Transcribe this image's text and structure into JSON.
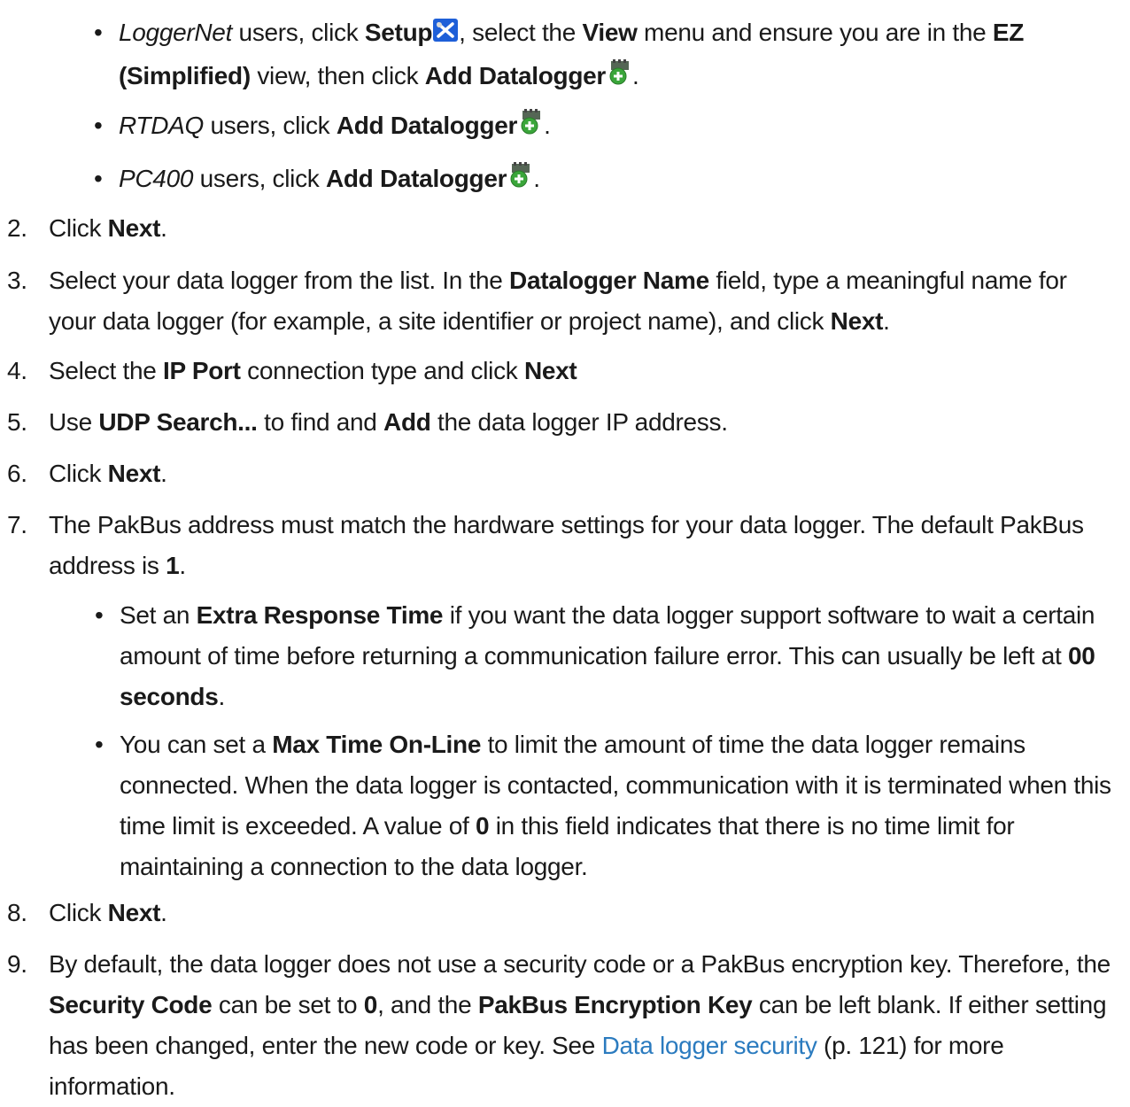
{
  "top_bullets": [
    {
      "app": "LoggerNet",
      "t1": " users, click ",
      "setup": "Setup",
      "t2": ", select the ",
      "view": "View",
      "t3": " menu and ensure you are in the ",
      "ez": "EZ (Simplified)",
      "t4": " view, then click ",
      "add": "Add Datalogger",
      "t5": "."
    },
    {
      "app": "RTDAQ",
      "t1": " users, click ",
      "add": "Add Datalogger",
      "t2": "."
    },
    {
      "app": "PC400",
      "t1": " users, click ",
      "add": "Add Datalogger",
      "t2": "."
    }
  ],
  "steps": {
    "s2": {
      "num": "2.",
      "t1": "Click ",
      "b1": "Next",
      "t2": "."
    },
    "s3": {
      "num": "3.",
      "t1": "Select your data logger from the list. In the ",
      "b1": "Datalogger Name",
      "t2": " field, type a meaningful name for your data logger (for example, a site identifier or project name), and click ",
      "b2": "Next",
      "t3": "."
    },
    "s4": {
      "num": "4.",
      "t1": "Select the ",
      "b1": "IP Port",
      "t2": " connection type and click ",
      "b2": "Next"
    },
    "s5": {
      "num": "5.",
      "t1": "Use ",
      "b1": "UDP Search...",
      "t2": " to find and ",
      "b2": "Add",
      "t3": " the data logger IP address."
    },
    "s6": {
      "num": "6.",
      "t1": "Click ",
      "b1": "Next",
      "t2": "."
    },
    "s7": {
      "num": "7.",
      "t1": "The PakBus address must match the hardware settings for your data logger. The default PakBus address is ",
      "b1": "1",
      "t2": "."
    },
    "s7a": {
      "t1": "Set an ",
      "b1": "Extra Response Time",
      "t2": " if you want the data logger support software to wait a certain amount of time before returning a communication failure error. This can usually be left at ",
      "b2": "00 seconds",
      "t3": "."
    },
    "s7b": {
      "t1": "You can set a ",
      "b1": "Max Time On-Line",
      "t2": " to limit the amount of time the data logger remains connected. When the data logger is contacted, communication with it is terminated when this time limit is exceeded. A value of ",
      "b2": "0",
      "t3": " in this field indicates that there is no time limit for maintaining a connection to the data logger."
    },
    "s8": {
      "num": "8.",
      "t1": "Click ",
      "b1": "Next",
      "t2": "."
    },
    "s9": {
      "num": "9.",
      "t1": "By default, the data logger does not use a security code or a PakBus encryption key. Therefore, the ",
      "b1": "Security Code",
      "t2": " can be set to ",
      "b2": "0",
      "t3": ", and the ",
      "b3": "PakBus Encryption Key",
      "t4": " can be left blank. If either setting has been changed, enter the new code or key. See ",
      "link": "Data logger security",
      "t5": " (p. 121) for more information."
    }
  },
  "bullet_char": "•",
  "colors": {
    "link": "#2b7bbf",
    "text": "#1a1a1a",
    "setup_icon_bg": "#1e5fd8",
    "add_icon_green": "#3aa63a"
  }
}
